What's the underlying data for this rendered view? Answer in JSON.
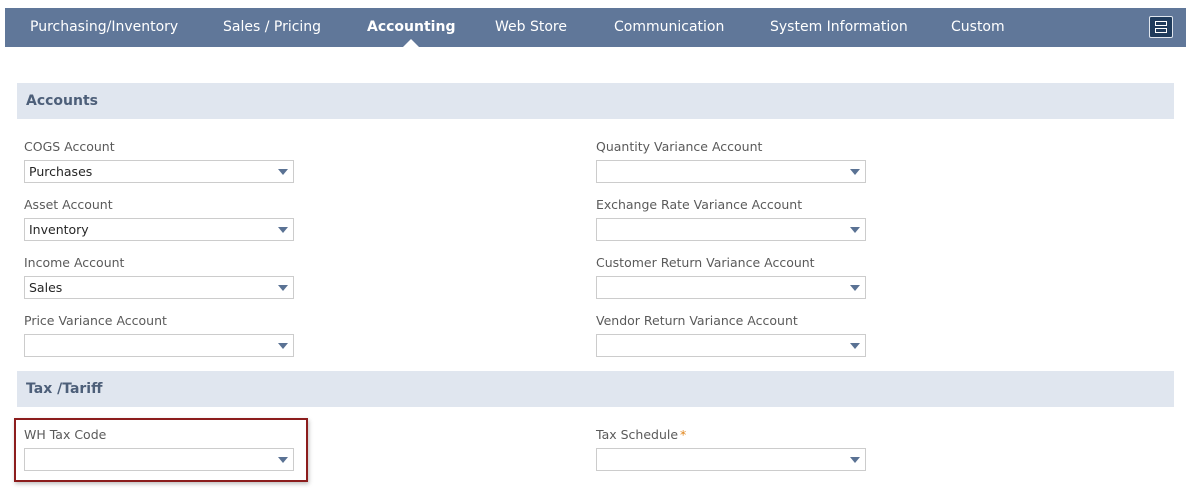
{
  "tabs": [
    {
      "label": "Purchasing/Inventory",
      "active": false
    },
    {
      "label": "Sales / Pricing",
      "active": false
    },
    {
      "label": "Accounting",
      "active": true
    },
    {
      "label": "Web Store",
      "active": false
    },
    {
      "label": "Communication",
      "active": false
    },
    {
      "label": "System Information",
      "active": false
    },
    {
      "label": "Custom",
      "active": false
    }
  ],
  "menu_toggle_icon": "stacked-panels-icon",
  "sections": {
    "accounts": {
      "title": "Accounts",
      "left_fields": [
        {
          "label": "COGS Account",
          "value": "Purchases"
        },
        {
          "label": "Asset Account",
          "value": "Inventory"
        },
        {
          "label": "Income Account",
          "value": "Sales"
        },
        {
          "label": "Price Variance Account",
          "value": ""
        }
      ],
      "right_fields": [
        {
          "label": "Quantity Variance Account",
          "value": ""
        },
        {
          "label": "Exchange Rate Variance Account",
          "value": ""
        },
        {
          "label": "Customer Return Variance Account",
          "value": ""
        },
        {
          "label": "Vendor Return Variance Account",
          "value": ""
        }
      ]
    },
    "tax": {
      "title": "Tax /Tariff",
      "left_fields": [
        {
          "label": "WH Tax Code",
          "value": "",
          "highlighted": true
        }
      ],
      "right_fields": [
        {
          "label": "Tax Schedule",
          "value": "",
          "required_marker": "*"
        }
      ]
    }
  },
  "colors": {
    "tab_bar": "#607799",
    "section_header_bg": "#e0e6ef",
    "section_header_text": "#4d5f79",
    "dropdown_arrow": "#5a7294",
    "required_marker": "#e0851b",
    "highlight_border": "#8c1d1d"
  }
}
